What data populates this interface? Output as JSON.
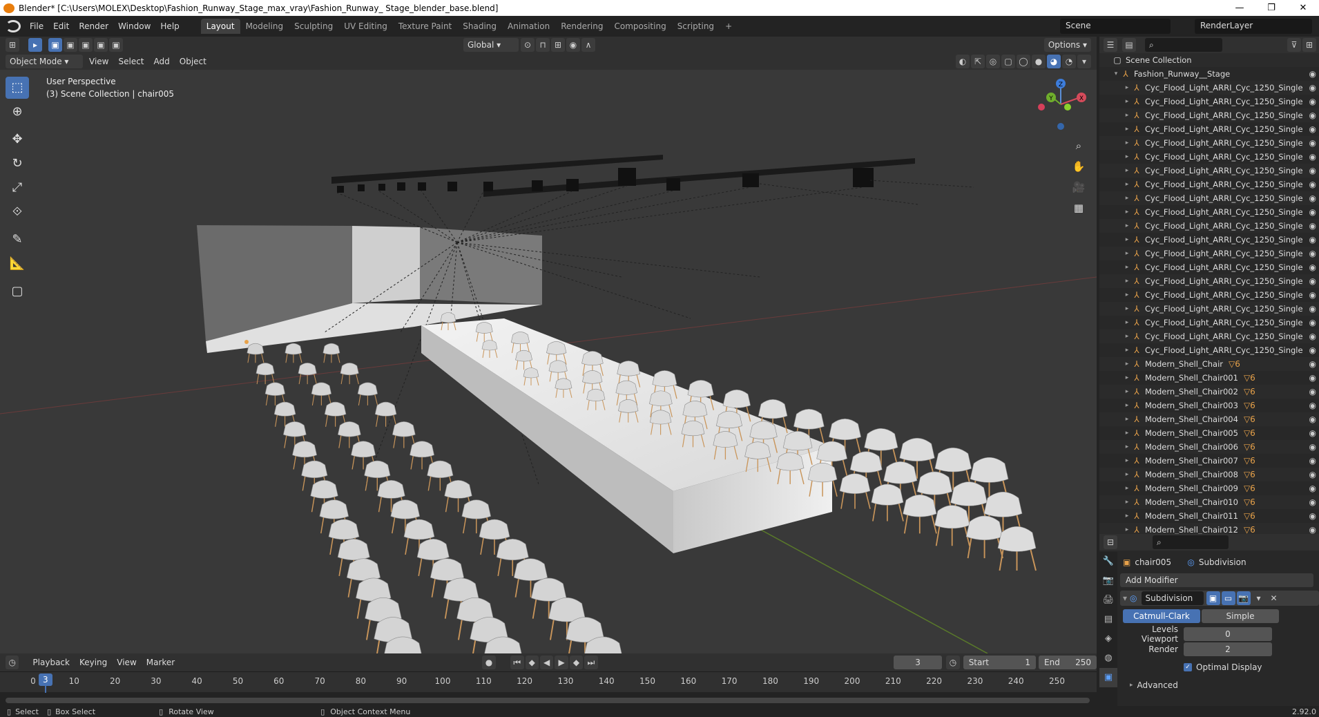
{
  "title_bar": {
    "text": "Blender* [C:\\Users\\MOLEX\\Desktop\\Fashion_Runway_Stage_max_vray\\Fashion_Runway_ Stage_blender_base.blend]",
    "minimize": "—",
    "maximize": "❐",
    "close": "✕"
  },
  "menu": {
    "items": [
      "File",
      "Edit",
      "Render",
      "Window",
      "Help"
    ]
  },
  "workspaces": {
    "tabs": [
      "Layout",
      "Modeling",
      "Sculpting",
      "UV Editing",
      "Texture Paint",
      "Shading",
      "Animation",
      "Rendering",
      "Compositing",
      "Scripting"
    ],
    "active": "Layout",
    "add": "+"
  },
  "scene": {
    "name": "Scene",
    "render_layer": "RenderLayer"
  },
  "viewport_header": {
    "transform_orientation": "Global",
    "options": "Options",
    "mode": "Object Mode",
    "menus": [
      "View",
      "Select",
      "Add",
      "Object"
    ]
  },
  "viewport": {
    "perspective": "User Perspective",
    "context": "(3) Scene Collection | chair005"
  },
  "gizmo": {
    "z": "Z",
    "y": "Y",
    "x": "X"
  },
  "timeline": {
    "menus": [
      "Playback",
      "Keying",
      "View",
      "Marker"
    ],
    "current_frame": "3",
    "start_label": "Start",
    "start": "1",
    "end_label": "End",
    "end": "250",
    "ticks": [
      "0",
      "10",
      "20",
      "30",
      "40",
      "50",
      "60",
      "70",
      "80",
      "90",
      "100",
      "110",
      "120",
      "130",
      "140",
      "150",
      "160",
      "170",
      "180",
      "190",
      "200",
      "210",
      "220",
      "230",
      "240",
      "250"
    ]
  },
  "statusbar": {
    "select": "Select",
    "box_select": "Box Select",
    "rotate_view": "Rotate View",
    "context_menu": "Object Context Menu",
    "version": "2.92.0"
  },
  "outliner": {
    "root": "Scene Collection",
    "collection": "Fashion_Runway__Stage",
    "items": [
      {
        "name": "Cyc_Flood_Light_ARRI_Cyc_1250_Single",
        "mod": ""
      },
      {
        "name": "Cyc_Flood_Light_ARRI_Cyc_1250_Single",
        "mod": ""
      },
      {
        "name": "Cyc_Flood_Light_ARRI_Cyc_1250_Single",
        "mod": ""
      },
      {
        "name": "Cyc_Flood_Light_ARRI_Cyc_1250_Single",
        "mod": ""
      },
      {
        "name": "Cyc_Flood_Light_ARRI_Cyc_1250_Single",
        "mod": ""
      },
      {
        "name": "Cyc_Flood_Light_ARRI_Cyc_1250_Single",
        "mod": ""
      },
      {
        "name": "Cyc_Flood_Light_ARRI_Cyc_1250_Single",
        "mod": ""
      },
      {
        "name": "Cyc_Flood_Light_ARRI_Cyc_1250_Single",
        "mod": ""
      },
      {
        "name": "Cyc_Flood_Light_ARRI_Cyc_1250_Single",
        "mod": ""
      },
      {
        "name": "Cyc_Flood_Light_ARRI_Cyc_1250_Single",
        "mod": ""
      },
      {
        "name": "Cyc_Flood_Light_ARRI_Cyc_1250_Single",
        "mod": ""
      },
      {
        "name": "Cyc_Flood_Light_ARRI_Cyc_1250_Single",
        "mod": ""
      },
      {
        "name": "Cyc_Flood_Light_ARRI_Cyc_1250_Single",
        "mod": ""
      },
      {
        "name": "Cyc_Flood_Light_ARRI_Cyc_1250_Single",
        "mod": ""
      },
      {
        "name": "Cyc_Flood_Light_ARRI_Cyc_1250_Single",
        "mod": ""
      },
      {
        "name": "Cyc_Flood_Light_ARRI_Cyc_1250_Single",
        "mod": ""
      },
      {
        "name": "Cyc_Flood_Light_ARRI_Cyc_1250_Single",
        "mod": ""
      },
      {
        "name": "Cyc_Flood_Light_ARRI_Cyc_1250_Single",
        "mod": ""
      },
      {
        "name": "Cyc_Flood_Light_ARRI_Cyc_1250_Single",
        "mod": ""
      },
      {
        "name": "Cyc_Flood_Light_ARRI_Cyc_1250_Single",
        "mod": ""
      },
      {
        "name": "Modern_Shell_Chair",
        "mod": "▽6"
      },
      {
        "name": "Modern_Shell_Chair001",
        "mod": "▽6"
      },
      {
        "name": "Modern_Shell_Chair002",
        "mod": "▽6"
      },
      {
        "name": "Modern_Shell_Chair003",
        "mod": "▽6"
      },
      {
        "name": "Modern_Shell_Chair004",
        "mod": "▽6"
      },
      {
        "name": "Modern_Shell_Chair005",
        "mod": "▽6"
      },
      {
        "name": "Modern_Shell_Chair006",
        "mod": "▽6"
      },
      {
        "name": "Modern_Shell_Chair007",
        "mod": "▽6"
      },
      {
        "name": "Modern_Shell_Chair008",
        "mod": "▽6"
      },
      {
        "name": "Modern_Shell_Chair009",
        "mod": "▽6"
      },
      {
        "name": "Modern_Shell_Chair010",
        "mod": "▽6"
      },
      {
        "name": "Modern_Shell_Chair011",
        "mod": "▽6"
      },
      {
        "name": "Modern_Shell_Chair012",
        "mod": "▽6"
      }
    ]
  },
  "properties": {
    "object": "chair005",
    "modifier_tab": "Subdivision",
    "add_modifier": "Add Modifier",
    "modifier_name": "Subdivision",
    "catmull_clark": "Catmull-Clark",
    "simple": "Simple",
    "levels_viewport_label": "Levels Viewport",
    "levels_viewport": "0",
    "render_label": "Render",
    "render_levels": "2",
    "optimal_display": "Optimal Display",
    "advanced": "Advanced"
  },
  "colors": {
    "accent": "#4772b3",
    "object_orange": "#e8a24a",
    "viewport_bg": "#393939"
  }
}
